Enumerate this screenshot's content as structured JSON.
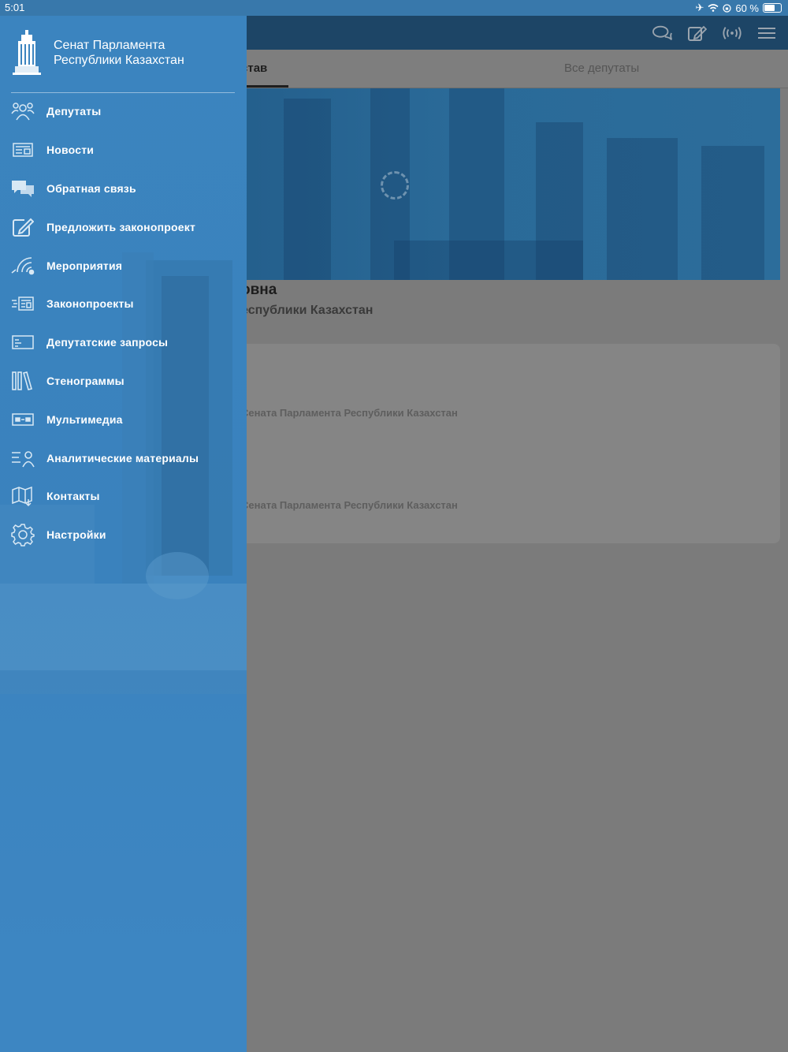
{
  "status": {
    "time": "5:01",
    "battery": "60 %"
  },
  "colors": {
    "drawer": "#3b84bf",
    "navbar": "#1d4566",
    "overlay": "#7b7b7b"
  },
  "drawer": {
    "title_line1": "Сенат Парламента",
    "title_line2": "Республики Казахстан",
    "items": [
      {
        "label": "Депутаты",
        "icon": "people-icon"
      },
      {
        "label": "Новости",
        "icon": "newspaper-icon"
      },
      {
        "label": "Обратная связь",
        "icon": "chat-bubbles-icon"
      },
      {
        "label": "Предложить законопроект",
        "icon": "edit-icon"
      },
      {
        "label": "Мероприятия",
        "icon": "broadcast-icon"
      },
      {
        "label": "Законопроекты",
        "icon": "document-list-icon"
      },
      {
        "label": "Депутатские запросы",
        "icon": "card-icon"
      },
      {
        "label": "Стенограммы",
        "icon": "books-icon"
      },
      {
        "label": "Мультимедиа",
        "icon": "media-icon"
      },
      {
        "label": "Аналитические материалы",
        "icon": "analytics-person-icon"
      },
      {
        "label": "Контакты",
        "icon": "map-icon"
      },
      {
        "label": "Настройки",
        "icon": "gear-icon"
      }
    ]
  },
  "main": {
    "tabs": {
      "active": "став",
      "all": "Все депутаты"
    },
    "person_name": "овна",
    "person_role": "еспублики Казахстан",
    "card_lines": [
      "Сената Парламента Республики Казахстан",
      "Сената Парламента Республики Казахстан"
    ]
  }
}
